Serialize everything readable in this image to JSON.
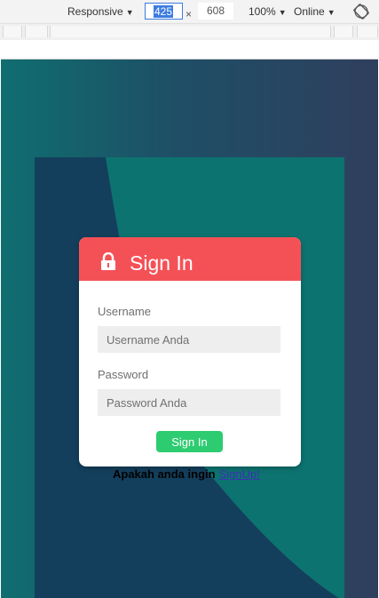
{
  "devtools": {
    "device_mode": "Responsive",
    "width_value": "425",
    "dimension_separator": "×",
    "height_value": "608",
    "zoom": "100%",
    "throttle": "Online",
    "rotate_icon": "rotate-icon"
  },
  "login": {
    "title": "Sign In",
    "title_icon": "lock-icon",
    "username_label": "Username",
    "username_placeholder": "Username Anda",
    "password_label": "Password",
    "password_placeholder": "Password Anda",
    "submit_label": "Sign In",
    "signup_prompt": "Apakah anda ingin",
    "signup_link": "SignUp!"
  },
  "colors": {
    "header": "#f45157",
    "button": "#2ecc71",
    "background_teal": "#0f6e70",
    "background_navy": "#2f3f5e"
  }
}
